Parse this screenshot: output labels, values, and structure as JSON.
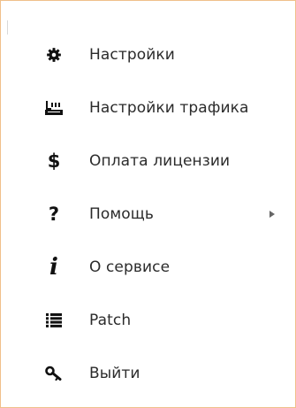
{
  "menu": {
    "items": [
      {
        "label": "Настройки",
        "icon": "gear-icon"
      },
      {
        "label": "Настройки трафика",
        "icon": "traffic-settings-icon"
      },
      {
        "label": "Оплата лицензии",
        "icon": "dollar-icon",
        "glyph": "$"
      },
      {
        "label": "Помощь",
        "icon": "question-icon",
        "glyph": "?",
        "has_submenu": true
      },
      {
        "label": "О сервисе",
        "icon": "info-icon",
        "glyph": "i"
      },
      {
        "label": "Patch",
        "icon": "list-icon"
      },
      {
        "label": "Выйти",
        "icon": "key-icon"
      }
    ]
  },
  "colors": {
    "border": "#f0c08a",
    "text": "#2b2b2b",
    "icon": "#111111",
    "arrow": "#666666"
  }
}
